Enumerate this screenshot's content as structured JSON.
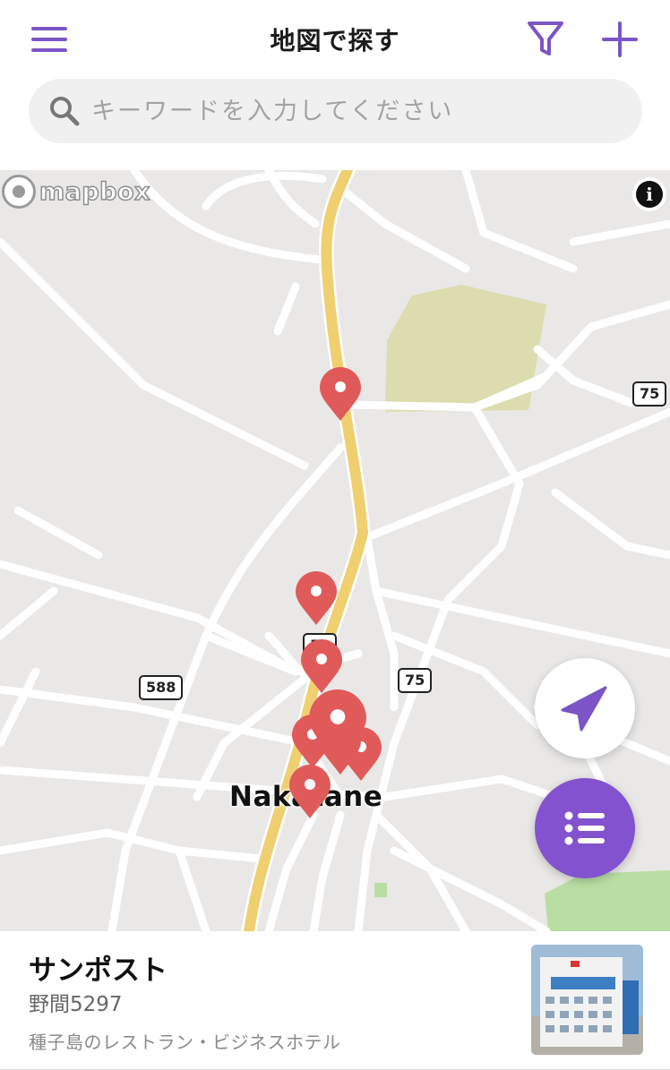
{
  "header": {
    "title": "地図で探す",
    "menu_icon": "hamburger-menu-icon",
    "filter_icon": "filter-funnel-icon",
    "add_icon": "plus-icon"
  },
  "search": {
    "placeholder": "キーワードを入力してください",
    "value": ""
  },
  "map": {
    "attribution_logo": "mapbox",
    "info_label": "i",
    "road_shields": [
      "75",
      "588",
      "75",
      "58"
    ],
    "place_label": "Nakatane",
    "marker_count": 8,
    "colors": {
      "map_background": "#e9e8e6",
      "road": "#ffffff",
      "highway": "#f0cf70",
      "park": "#dcdcaf",
      "green": "#b9dea3",
      "marker": "#e05a5a"
    }
  },
  "controls": {
    "locate_icon": "navigation-arrow-icon",
    "list_icon": "list-icon"
  },
  "place_card": {
    "name": "サンポスト",
    "address": "野間5297",
    "description": "種子島のレストラン・ビジネスホテル",
    "thumbnail_label": "サンポスト"
  },
  "theme": {
    "accent": "#8352cf",
    "icon_purple": "#7b55c7"
  }
}
